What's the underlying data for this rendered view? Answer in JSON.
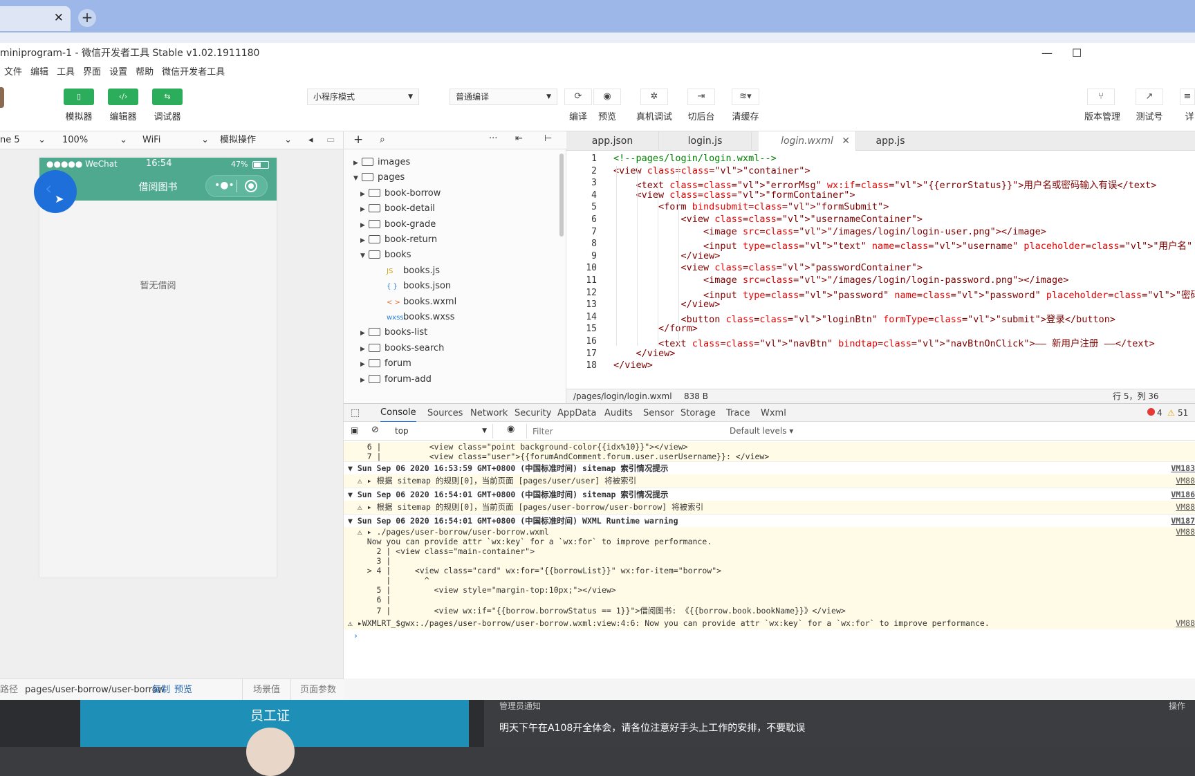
{
  "browser": {
    "close_glyph": "✕",
    "new_tab_glyph": "+"
  },
  "ide": {
    "title": "miniprogram-1 - 微信开发者工具 Stable v1.02.1911180",
    "minimize_glyph": "—",
    "maximize_glyph": "☐",
    "menu": [
      "文件",
      "编辑",
      "工具",
      "界面",
      "设置",
      "帮助",
      "微信开发者工具"
    ]
  },
  "toolbar": {
    "simulator": "模拟器",
    "editor": "编辑器",
    "debugger": "调试器",
    "mode_select": "小程序模式",
    "compile_select": "普通编译",
    "compile": "编译",
    "preview": "预览",
    "real_debug": "真机调试",
    "background": "切后台",
    "clear_cache": "清缓存",
    "version_mgmt": "版本管理",
    "test_account": "测试号",
    "details": "详"
  },
  "simbar": {
    "device": "ne 5",
    "zoom": "100%",
    "network": "WiFi",
    "operation": "模拟操作"
  },
  "phone": {
    "carrier": "●●●●● WeChat",
    "time": "16:54",
    "battery": "47%",
    "nav_title": "借阅图书",
    "empty_text": "暂无借阅"
  },
  "sim_footer": {
    "path_label": "路径",
    "path": "pages/user-borrow/user-borrow",
    "copy": "复制",
    "preview": "预览",
    "scene": "场景值",
    "page_params": "页面参数"
  },
  "file_tree": [
    {
      "label": "images",
      "type": "folder",
      "depth": 0,
      "open": false
    },
    {
      "label": "pages",
      "type": "folder",
      "depth": 0,
      "open": true
    },
    {
      "label": "book-borrow",
      "type": "folder",
      "depth": 1,
      "open": false
    },
    {
      "label": "book-detail",
      "type": "folder",
      "depth": 1,
      "open": false
    },
    {
      "label": "book-grade",
      "type": "folder",
      "depth": 1,
      "open": false
    },
    {
      "label": "book-return",
      "type": "folder",
      "depth": 1,
      "open": false
    },
    {
      "label": "books",
      "type": "folder",
      "depth": 1,
      "open": true
    },
    {
      "label": "books.js",
      "type": "js",
      "depth": 2
    },
    {
      "label": "books.json",
      "type": "json",
      "depth": 2
    },
    {
      "label": "books.wxml",
      "type": "wxml",
      "depth": 2
    },
    {
      "label": "books.wxss",
      "type": "wxss",
      "depth": 2
    },
    {
      "label": "books-list",
      "type": "folder",
      "depth": 1,
      "open": false
    },
    {
      "label": "books-search",
      "type": "folder",
      "depth": 1,
      "open": false
    },
    {
      "label": "forum",
      "type": "folder",
      "depth": 1,
      "open": false
    },
    {
      "label": "forum-add",
      "type": "folder",
      "depth": 1,
      "open": false
    }
  ],
  "file_icons": {
    "js": "JS",
    "json": "{ }",
    "wxml": "< >",
    "wxss": "wxss"
  },
  "editor_tabs": [
    "app.json",
    "login.js",
    "login.wxml",
    "app.js"
  ],
  "editor_lines": [
    "<!--pages/login/login.wxml-->",
    "<view class=\"container\">",
    "    <text class=\"errorMsg\" wx:if=\"{{errorStatus}}\">用户名或密码输入有误</text>",
    "    <view class=\"formContainer\">",
    "        <form bindsubmit=\"formSubmit\">",
    "            <view class=\"usernameContainer\">",
    "                <image src=\"/images/login/login-user.png\"></image>",
    "                <input type=\"text\" name=\"username\" placeholder=\"用户名\" />",
    "            </view>",
    "            <view class=\"passwordContainer\">",
    "                <image src=\"/images/login/login-password.png\"></image>",
    "                <input type=\"password\" name=\"password\" placeholder=\"密码\" />",
    "            </view>",
    "            <button class=\"loginBtn\" formType=\"submit\">登录</button>",
    "        </form>",
    "        <text class=\"navBtn\" bindtap=\"navBtnOnClick\">—— 新用户注册 ——</text>",
    "    </view>",
    "</view>"
  ],
  "editor_status": {
    "path": "/pages/login/login.wxml",
    "size": "838 B",
    "cursor": "行 5，列 36"
  },
  "devtools": {
    "tabs": [
      "Console",
      "Sources",
      "Network",
      "Security",
      "AppData",
      "Audits",
      "Sensor",
      "Storage",
      "Trace",
      "Wxml"
    ],
    "errors": "4",
    "warnings": "51",
    "context": "top",
    "filter_placeholder": "Filter",
    "levels": "Default levels ▾"
  },
  "console_lines": [
    {
      "text": "    6 |          <view class=\"point background-color{{idx%10}}\"></view>",
      "kind": "code",
      "src": ""
    },
    {
      "text": "    7 |          <view class=\"user\">{{forumAndComment.forum.user.userUsername}}: </view>",
      "kind": "code",
      "src": ""
    },
    {
      "text": "▼ Sun Sep 06 2020 16:53:59 GMT+0800 (中国标准时间) sitemap 索引情况提示",
      "kind": "group",
      "src": "VM183"
    },
    {
      "text": "  ⚠ ▸ 根据 sitemap 的规则[0]，当前页面 [pages/user/user] 将被索引",
      "kind": "warn",
      "src": "VM88"
    },
    {
      "text": "▼ Sun Sep 06 2020 16:54:01 GMT+0800 (中国标准时间) sitemap 索引情况提示",
      "kind": "group",
      "src": "VM186"
    },
    {
      "text": "  ⚠ ▸ 根据 sitemap 的规则[0]，当前页面 [pages/user-borrow/user-borrow] 将被索引",
      "kind": "warn",
      "src": "VM88"
    },
    {
      "text": "▼ Sun Sep 06 2020 16:54:01 GMT+0800 (中国标准时间) WXML Runtime warning",
      "kind": "group",
      "src": "VM187"
    },
    {
      "text": "  ⚠ ▸ ./pages/user-borrow/user-borrow.wxml",
      "kind": "warn",
      "src": "VM88"
    },
    {
      "text": "    Now you can provide attr `wx:key` for a `wx:for` to improve performance.",
      "kind": "code",
      "src": ""
    },
    {
      "text": "      2 | <view class=\"main-container\">",
      "kind": "code",
      "src": ""
    },
    {
      "text": "      3 |",
      "kind": "code",
      "src": ""
    },
    {
      "text": "    > 4 |     <view class=\"card\" wx:for=\"{{borrowList}}\" wx:for-item=\"borrow\">",
      "kind": "code",
      "src": ""
    },
    {
      "text": "        |       ^",
      "kind": "code",
      "src": ""
    },
    {
      "text": "      5 |         <view style=\"margin-top:10px;\"></view>",
      "kind": "code",
      "src": ""
    },
    {
      "text": "      6 |",
      "kind": "code",
      "src": ""
    },
    {
      "text": "      7 |         <view wx:if=\"{{borrow.borrowStatus == 1}}\">借阅图书: 《{{borrow.book.bookName}}》</view>",
      "kind": "code",
      "src": ""
    },
    {
      "text": "⚠ ▸WXMLRT_$gwx:./pages/user-borrow/user-borrow.wxml:view:4:6: Now you can provide attr `wx:key` for a `wx:for` to improve performance.",
      "kind": "warnline",
      "src": "VM88"
    },
    {
      "text": "›",
      "kind": "prompt",
      "src": ""
    }
  ],
  "background_page": {
    "card_title": "员工证",
    "notice_header": "管理员通知",
    "notice_action": "操作",
    "notice_text": "明天下午在A108开全体会，请各位注意好手头上工作的安排，不要耽误"
  },
  "colors": {
    "green": "#2bad5b",
    "teal": "#4fa98f",
    "blue_highlight": "#1e6fd9",
    "tag": "#800000",
    "attr": "#e50000",
    "value": "#0000ff",
    "comment": "#008000"
  }
}
